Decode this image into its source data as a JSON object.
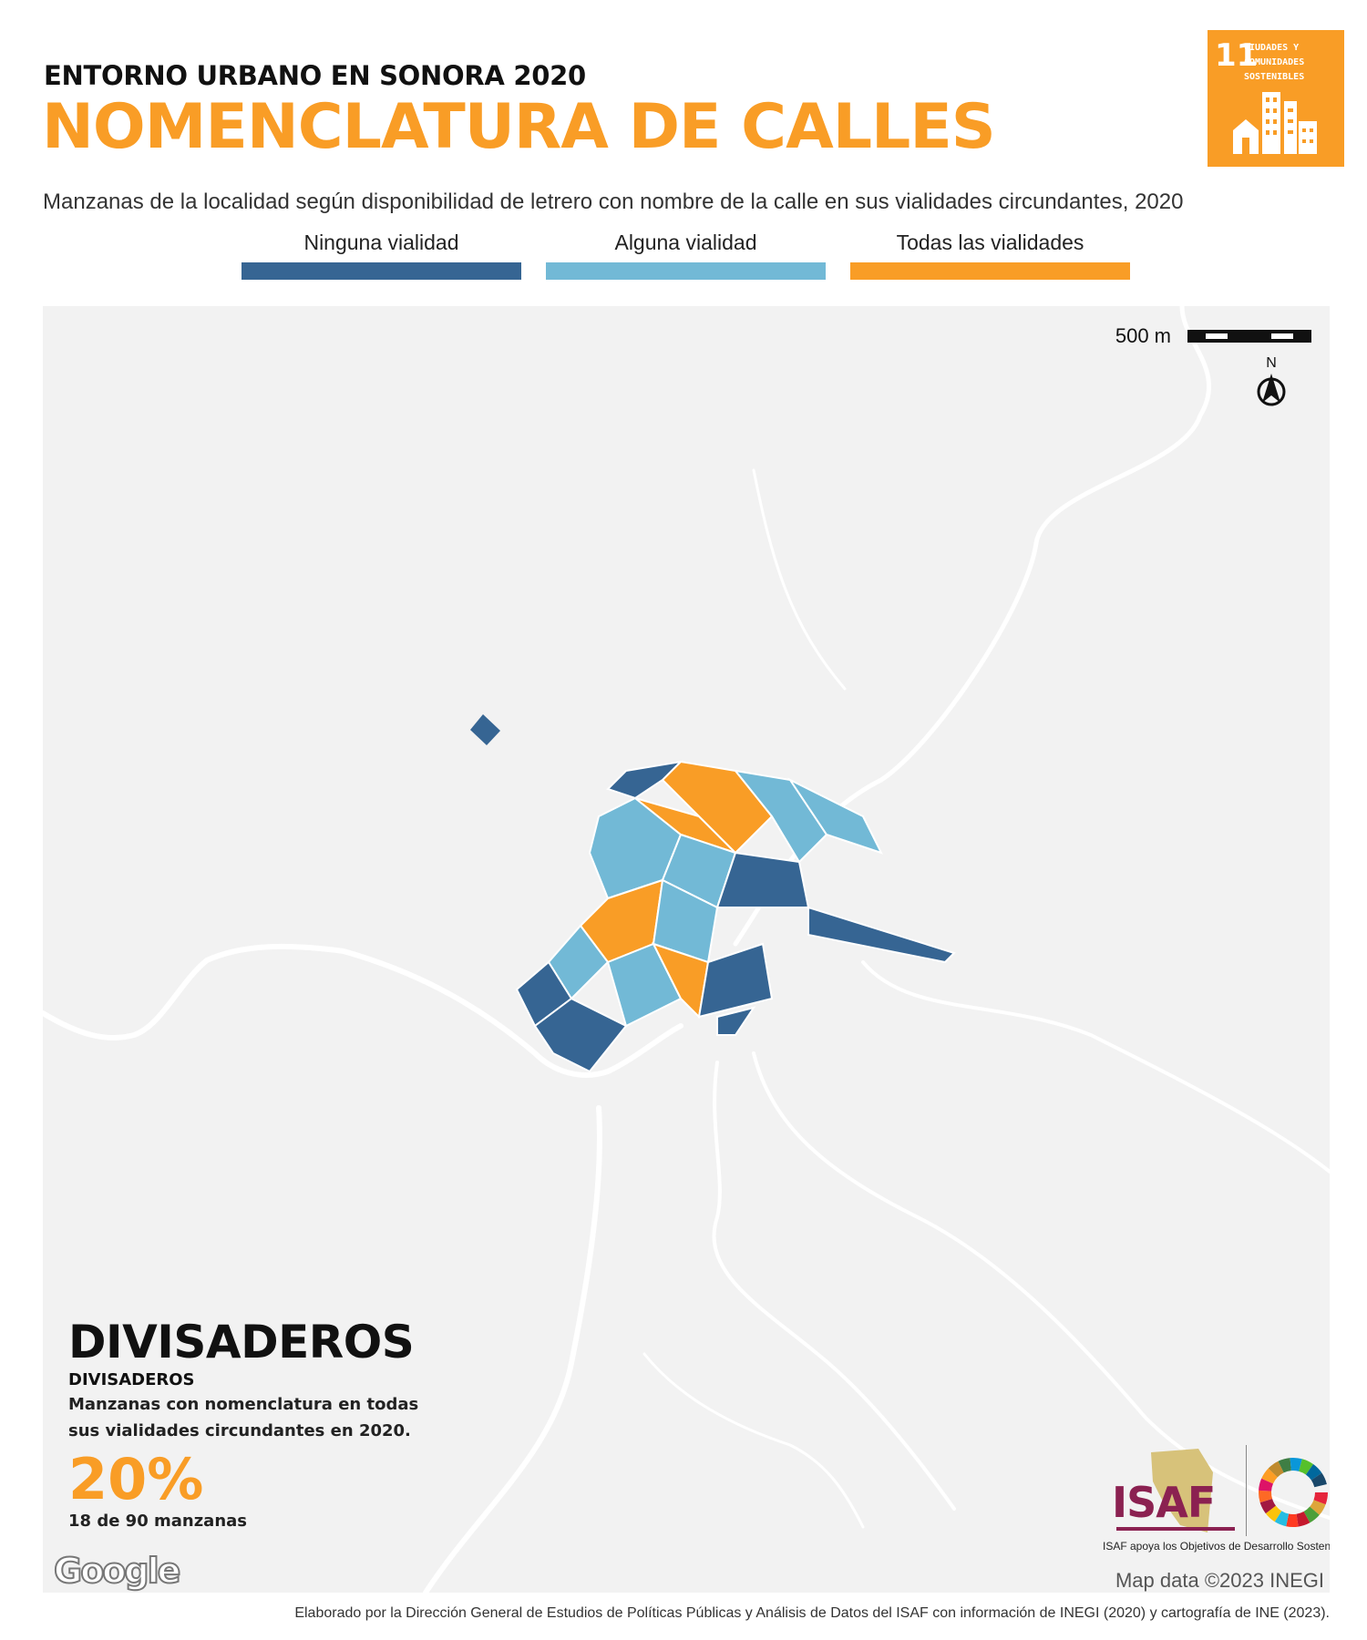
{
  "header": {
    "supertitle": "ENTORNO URBANO EN SONORA 2020",
    "title": "NOMENCLATURA DE CALLES",
    "subtitle": "Manzanas de la localidad según disponibilidad de letrero con nombre de la calle en sus vialidades circundantes, 2020"
  },
  "sdg_badge": {
    "number": "11",
    "text": "CIUDADES Y COMUNIDADES SOSTENIBLES",
    "color": "#f99d26",
    "icon": "city-buildings-icon"
  },
  "legend": [
    {
      "label": "Ninguna vialidad",
      "color": "#366593"
    },
    {
      "label": "Alguna vialidad",
      "color": "#72b9d6"
    },
    {
      "label": "Todas las vialidades",
      "color": "#f99d26"
    }
  ],
  "map": {
    "scale_label": "500 m",
    "north_label": "N",
    "locality_name": "DIVISADEROS",
    "locality_subname": "DIVISADEROS",
    "description": "Manzanas con nomenclatura en todas sus vialidades circundantes en 2020.",
    "percentage": "20%",
    "count_text": "18 de 90 manzanas",
    "google_label": "Google",
    "attribution": "Map data ©2023 INEGI",
    "background_color": "#f2f2f2"
  },
  "logos": {
    "isaf_label": "ISAF",
    "caption": "ISAF apoya los Objetivos de Desarrollo Sostenible"
  },
  "footer": {
    "credits": "Elaborado por la Dirección General de Estudios de Políticas Públicas y Análisis de Datos del ISAF con información de INEGI (2020) y cartografía de INE (2023)."
  }
}
